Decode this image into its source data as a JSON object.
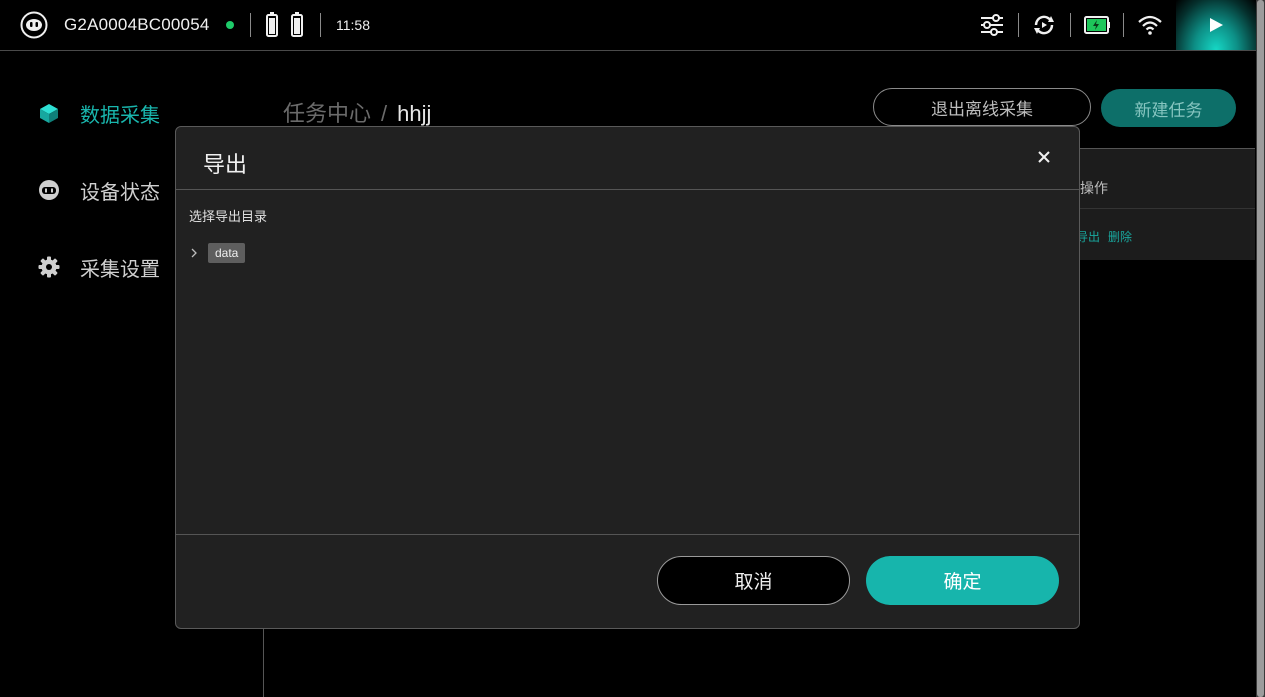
{
  "statusbar": {
    "device_id": "G2A0004BC00054",
    "online_color": "#1ecb6a",
    "time": "11:58",
    "icons": [
      "robot-icon",
      "battery-icon",
      "battery-icon",
      "sliders-icon",
      "sync-icon",
      "charging-battery-icon",
      "wifi-icon",
      "play-icon"
    ]
  },
  "sidebar": {
    "items": [
      {
        "label": "数据采集",
        "icon": "cube-icon",
        "active": true
      },
      {
        "label": "设备状态",
        "icon": "robot-face-icon",
        "active": false
      },
      {
        "label": "采集设置",
        "icon": "gear-icon",
        "active": false
      }
    ]
  },
  "header": {
    "breadcrumb_root": "任务中心",
    "breadcrumb_sep": "/",
    "breadcrumb_current": "hhjj",
    "exit_offline_label": "退出离线采集",
    "new_task_label": "新建任务"
  },
  "table": {
    "ops_header": "操作",
    "row_actions": [
      "导出",
      "删除"
    ]
  },
  "dialog": {
    "title": "导出",
    "subtitle": "选择导出目录",
    "tree": [
      {
        "label": "data",
        "expanded": false
      }
    ],
    "cancel_label": "取消",
    "confirm_label": "确定"
  },
  "colors": {
    "accent": "#17b5ac",
    "background": "#000000",
    "dialog_bg": "#212121"
  }
}
